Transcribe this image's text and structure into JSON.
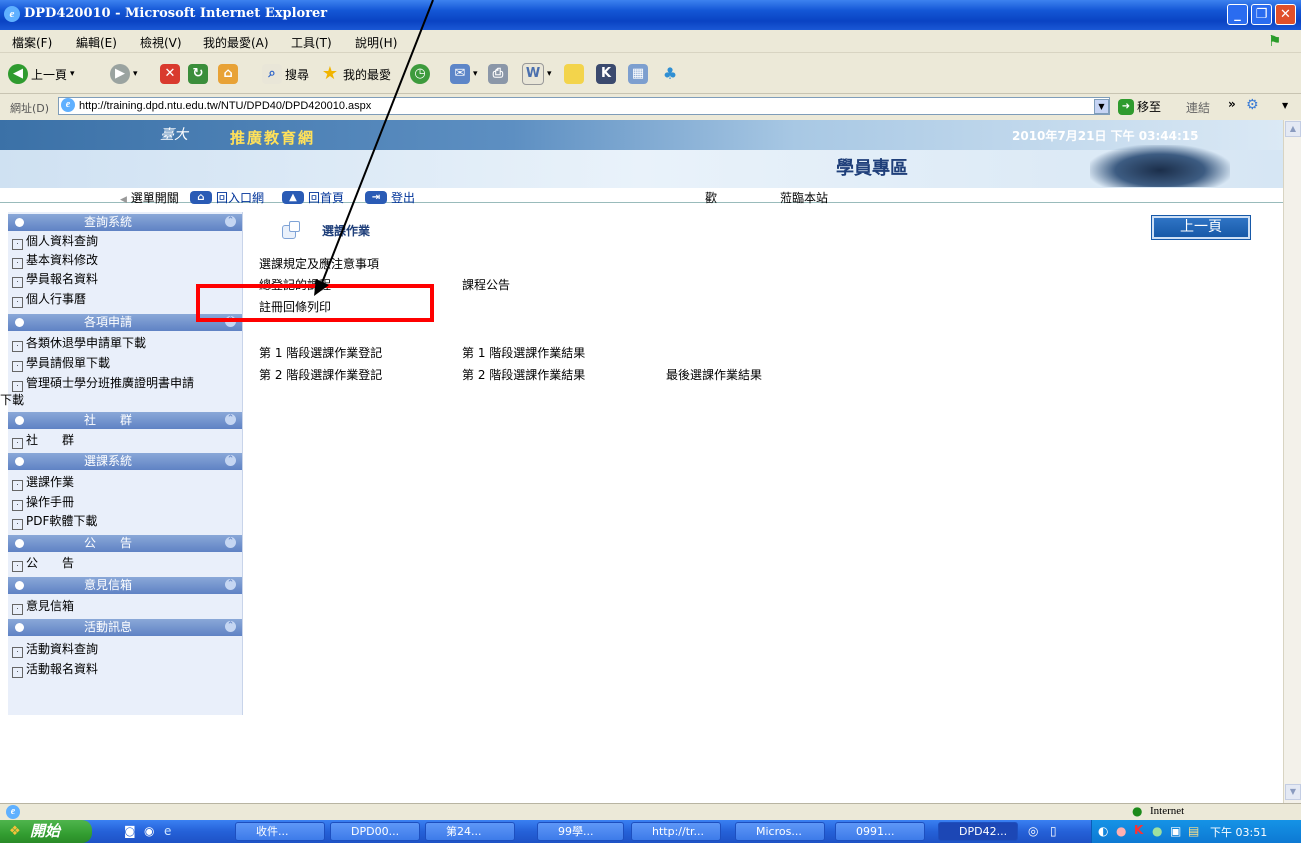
{
  "window": {
    "title": "DPD420010 - Microsoft Internet Explorer"
  },
  "menu": [
    "檔案(F)",
    "編輯(E)",
    "檢視(V)",
    "我的最愛(A)",
    "工具(T)",
    "說明(H)"
  ],
  "toolbar": {
    "back": "上一頁",
    "search": "搜尋",
    "favorites": "我的最愛"
  },
  "address": {
    "label": "網址(D)",
    "url": "http://training.dpd.ntu.edu.tw/NTU/DPD40/DPD420010.aspx",
    "go": "移至",
    "links": "連結"
  },
  "header": {
    "site_name": "推廣教育網",
    "datetime": "2010年7月21日 下午 03:44:15",
    "zone": "學員專區",
    "nav": {
      "menu_toggle": "選單開關",
      "portal": "回入口網",
      "home": "回首頁",
      "logout": "登出"
    },
    "welcome_left": "歡",
    "welcome_right": "蒞臨本站"
  },
  "sidebar": [
    {
      "title": "查詢系統",
      "items": [
        "個人資料查詢",
        "基本資料修改",
        "學員報名資料",
        "個人行事曆"
      ]
    },
    {
      "title": "各項申請",
      "items": [
        "各類休退學申請單下載",
        "學員請假單下載",
        "管理碩士學分班推廣證明書申請",
        "下載"
      ]
    },
    {
      "title": "社　　群",
      "items": [
        "社　　群"
      ]
    },
    {
      "title": "選課系統",
      "items": [
        "選課作業",
        "操作手冊",
        "PDF軟體下載"
      ]
    },
    {
      "title": "公　　告",
      "items": [
        "公　　告"
      ]
    },
    {
      "title": "意見信箱",
      "items": [
        "意見信箱"
      ]
    },
    {
      "title": "活動訊息",
      "items": [
        "活動資料查詢",
        "活動報名資料"
      ]
    }
  ],
  "main": {
    "title": "選課作業",
    "back_button": "上一頁",
    "rules": "選課規定及應注意事項",
    "registered_left": "總登記的課程",
    "course_notice": "課程公告",
    "print_receipt": "註冊回條列印",
    "stage1_register": "第 1 階段選課作業登記",
    "stage1_result": "第 1 階段選課作業結果",
    "stage2_register": "第 2 階段選課作業登記",
    "stage2_result": "第 2 階段選課作業結果",
    "final_result": "最後選課作業結果"
  },
  "status": {
    "zone": "Internet"
  },
  "taskbar": {
    "start": "開始",
    "tasks": [
      "收件...",
      "DPD00...",
      "第24...",
      "99學...",
      "http://tr...",
      "Micros...",
      "0991...",
      "DPD42..."
    ],
    "clock": "下午 03:51"
  },
  "colors": {
    "highlight_box": "#ff0000",
    "link_blue": "#003399",
    "sidebar_header": "#6f8fcc"
  }
}
